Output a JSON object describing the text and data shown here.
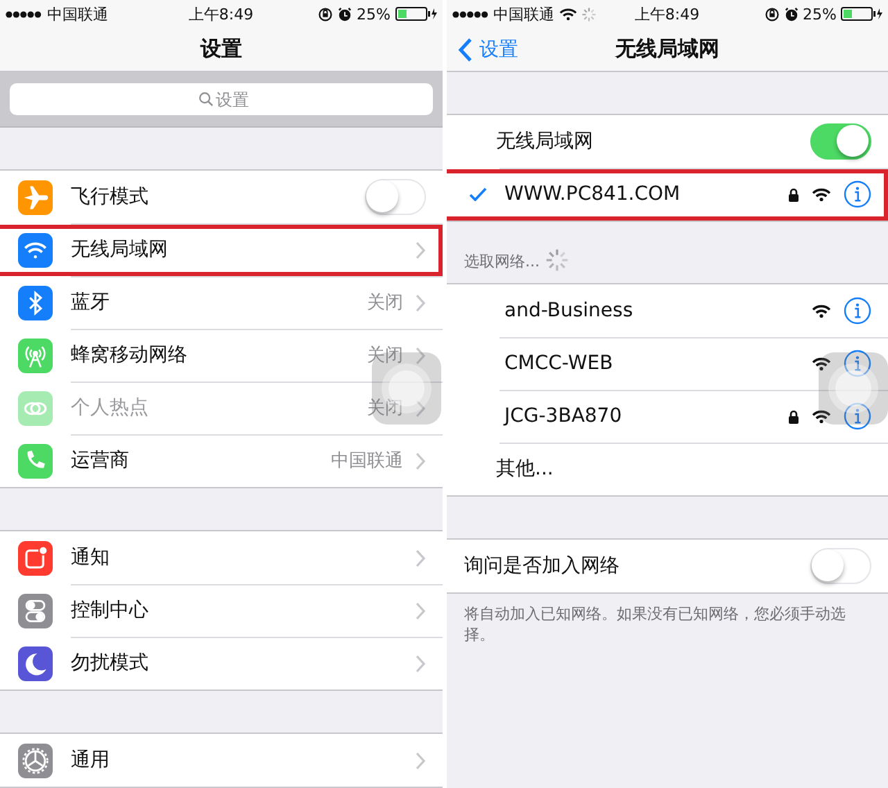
{
  "panels": [
    {
      "status_bar": {
        "carrier": "中国联通",
        "time": "上午8:49",
        "battery": "25%"
      },
      "nav": {
        "title": "设置"
      },
      "search": {
        "placeholder": "设置"
      },
      "groups": [
        {
          "rows": [
            {
              "kind": "toggle",
              "color": "#ff9500",
              "label": "飞行模式",
              "on": false
            },
            {
              "kind": "setting",
              "color": "#147efb",
              "label": "无线局域网",
              "highlighted": true
            },
            {
              "kind": "setting",
              "color": "#147efb",
              "label": "蓝牙",
              "value": "关闭"
            },
            {
              "kind": "setting",
              "color": "#4cd964",
              "label": "蜂窝移动网络",
              "value": "关闭"
            },
            {
              "kind": "setting",
              "color": "#a6ebb2",
              "label": "个人热点",
              "value": "关闭",
              "disabled": true
            },
            {
              "kind": "setting",
              "color": "#4cd964",
              "label": "运营商",
              "value": "中国联通"
            }
          ]
        },
        {
          "rows": [
            {
              "kind": "setting",
              "color": "#ff3b30",
              "label": "通知"
            },
            {
              "kind": "setting",
              "color": "#8e8e93",
              "label": "控制中心"
            },
            {
              "kind": "setting",
              "color": "#5856d6",
              "label": "勿扰模式"
            }
          ]
        },
        {
          "rows": [
            {
              "kind": "setting",
              "color": "#8e8e93",
              "label": "通用"
            }
          ]
        }
      ]
    },
    {
      "status_bar": {
        "carrier": "中国联通",
        "time": "上午8:49",
        "battery": "25%",
        "wifi": true,
        "loading": true
      },
      "nav": {
        "back": "设置",
        "title": "无线局域网"
      },
      "groups": [
        {
          "rows": [
            {
              "kind": "master-toggle",
              "label": "无线局域网",
              "on": true
            },
            {
              "kind": "network",
              "label": "WWW.PC841.COM",
              "selected": true,
              "locked": true,
              "highlighted": true
            }
          ]
        },
        {
          "header": "选取网络...",
          "loading": true,
          "rows": [
            {
              "kind": "network",
              "label": "and-Business",
              "selected": false,
              "locked": false
            },
            {
              "kind": "network",
              "label": "CMCC-WEB",
              "selected": false,
              "locked": false
            },
            {
              "kind": "network",
              "label": "JCG-3BA870",
              "selected": false,
              "locked": true
            },
            {
              "kind": "link",
              "label": "其他..."
            }
          ]
        },
        {
          "rows": [
            {
              "kind": "toggle",
              "label": "询问是否加入网络",
              "on": false
            }
          ],
          "footer": "将自动加入已知网络。如果没有已知网络，您必须手动选择。"
        }
      ]
    }
  ]
}
